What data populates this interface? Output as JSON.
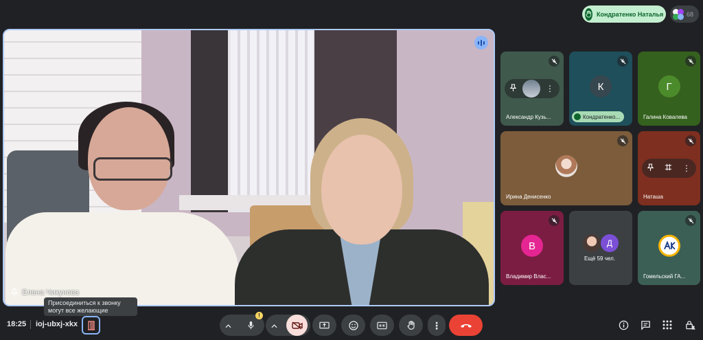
{
  "top": {
    "raised_hand_name": "Кондратенко Наталья",
    "participants_count": "68"
  },
  "main": {
    "presenter_name": "Елена Чикунова",
    "tooltip": "Присоединиться к звонку могут все желающие"
  },
  "tiles": [
    {
      "name": "Александр Кузь...",
      "bg": "#3f5a4d"
    },
    {
      "name": "Кондратенко...",
      "bg": "#1e4f5b",
      "avatar_letter": "К",
      "avatar_bg": "#37474f"
    },
    {
      "name": "Галина Ковалева",
      "bg": "#35611f",
      "avatar_letter": "Г",
      "avatar_bg": "#4c8b2b"
    },
    {
      "name": "Ирина Денисенко",
      "bg": "#7c5c3b"
    },
    {
      "name": "Наташа",
      "bg": "#7e2f1f"
    },
    {
      "name": "Владимир Влас...",
      "bg": "#7b1d42",
      "avatar_letter": "В",
      "avatar_bg": "#e52592"
    },
    {
      "name": "Ещё 59 чел.",
      "bg": "#3c4043",
      "avatar_letter": "Д",
      "avatar_bg": "#7b4fd6"
    },
    {
      "name": "Гомельский ГА...",
      "bg": "#3c5f55"
    }
  ],
  "bottom": {
    "time": "18:25",
    "meeting_code": "ioj-ubxj-xkx",
    "mic_badge": "!"
  },
  "colors": {
    "accent": "#8ab4f8",
    "end_call": "#ea4335",
    "raise_hand_bg": "#c4eed0"
  }
}
